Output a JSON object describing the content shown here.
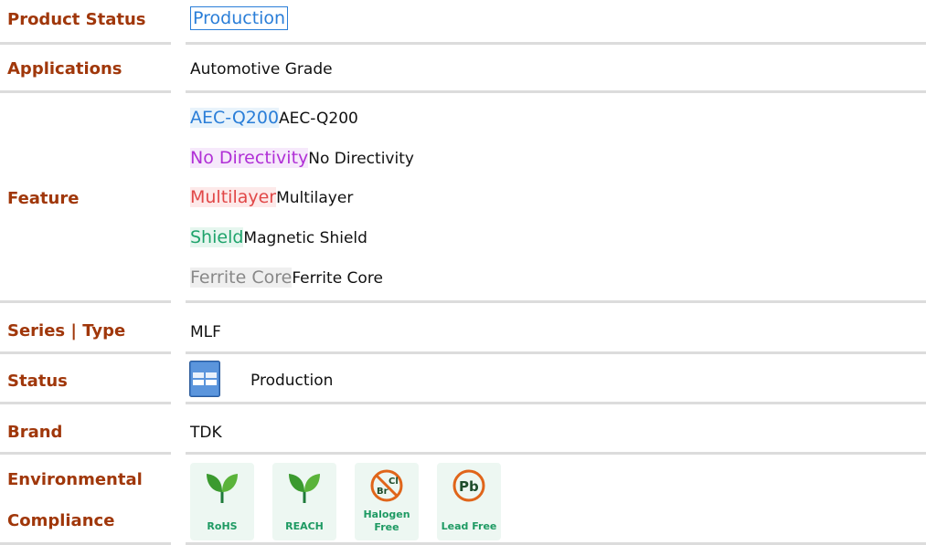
{
  "rows": {
    "product_status": {
      "label": "Product Status",
      "value": "Production"
    },
    "applications": {
      "label": "Applications",
      "value": "Automotive Grade"
    },
    "feature": {
      "label": "Feature",
      "items": [
        {
          "tag": "AEC-Q200",
          "text": "AEC-Q200"
        },
        {
          "tag": "No Directivity",
          "text": "No Directivity"
        },
        {
          "tag": "Multilayer",
          "text": "Multilayer"
        },
        {
          "tag": "Shield",
          "text": "Magnetic Shield"
        },
        {
          "tag": "Ferrite Core",
          "text": "Ferrite Core"
        }
      ]
    },
    "series_type": {
      "label": "Series | Type",
      "value": "MLF"
    },
    "status": {
      "label": "Status",
      "value": "Production",
      "icon": "production-status-icon"
    },
    "brand": {
      "label": "Brand",
      "value": "TDK"
    },
    "environmental": {
      "label_line1": "Environmental",
      "label_line2": "Compliance",
      "badges": [
        {
          "name": "RoHS",
          "icon": "leaf-icon"
        },
        {
          "name": "REACH",
          "icon": "leaf-icon"
        },
        {
          "name_line1": "Halogen",
          "name_line2": "Free",
          "icon": "halogen-free-icon",
          "glyph_top": "Cl",
          "glyph_bottom": "Br"
        },
        {
          "name": "Lead Free",
          "icon": "lead-free-icon",
          "glyph": "Pb"
        }
      ]
    }
  },
  "colors": {
    "label": "#a0370a",
    "accent_blue": "#2a7ed8",
    "green": "#1e9a63",
    "orange": "#e0651a"
  }
}
